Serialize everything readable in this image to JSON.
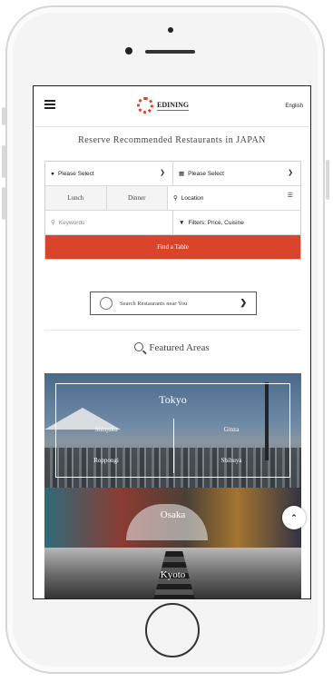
{
  "header": {
    "logo_text": "EDINING",
    "language": "English"
  },
  "search": {
    "headline": "Reserve Recommended Restaurants in JAPAN",
    "area_select": "Please Select",
    "date_select": "Please Select",
    "meal_lunch": "Lunch",
    "meal_dinner": "Dinner",
    "location": "Location",
    "keyword_placeholder": "Keywords",
    "filters": "Filters: Price, Cuisine",
    "find_button": "Find a Table",
    "near_button": "Search Restaurants near You"
  },
  "featured": {
    "title": "Featured Areas",
    "areas": [
      {
        "name": "Tokyo",
        "subareas": [
          "Shinjuku",
          "Ginza",
          "Roppongi",
          "Shibuya"
        ]
      },
      {
        "name": "Osaka"
      },
      {
        "name": "Kyoto"
      }
    ]
  },
  "colors": {
    "accent": "#d9442b"
  }
}
